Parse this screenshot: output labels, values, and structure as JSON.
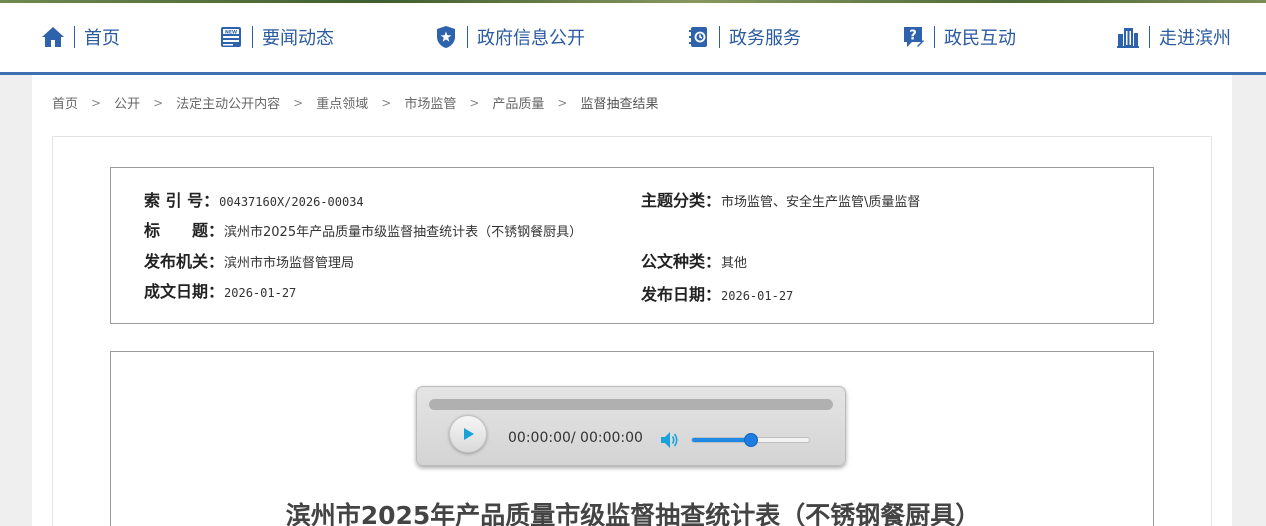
{
  "nav": {
    "items": [
      {
        "label": "首页",
        "icon": "home-icon"
      },
      {
        "label": "要闻动态",
        "icon": "news-icon"
      },
      {
        "label": "政府信息公开",
        "icon": "badge-icon"
      },
      {
        "label": "政务服务",
        "icon": "service-book-icon"
      },
      {
        "label": "政民互动",
        "icon": "question-icon"
      },
      {
        "label": "走进滨州",
        "icon": "building-icon"
      }
    ]
  },
  "breadcrumb": {
    "items": [
      "首页",
      "公开",
      "法定主动公开内容",
      "重点领域",
      "市场监管",
      "产品质量"
    ],
    "separator": ">",
    "current": "监督抽查结果"
  },
  "meta": {
    "index_label": "索 引 号：",
    "index_value": "00437160X/2026-00034",
    "topic_label": "主题分类：",
    "topic_value": "市场监管、安全生产监管\\质量监督",
    "title_label": "标　　题：",
    "title_value": "滨州市2025年产品质量市级监督抽查统计表（不锈钢餐厨具）",
    "issuer_label": "发布机关：",
    "issuer_value": "滨州市市场监督管理局",
    "doctype_label": "公文种类：",
    "doctype_value": "其他",
    "written_label": "成文日期：",
    "written_value": "2026-01-27",
    "published_label": "发布日期：",
    "published_value": "2026-01-27"
  },
  "player": {
    "time": "00:00:00/ 00:00:00",
    "progress": 0,
    "volume": 0.5
  },
  "document": {
    "title": "滨州市2025年产品质量市级监督抽查统计表（不锈钢餐厨具）"
  },
  "colors": {
    "nav_text": "#2a5aa0",
    "nav_bar": "#3e6fb1",
    "player_play": "#1aa3d9",
    "volume_fill": "#1e88e5"
  }
}
